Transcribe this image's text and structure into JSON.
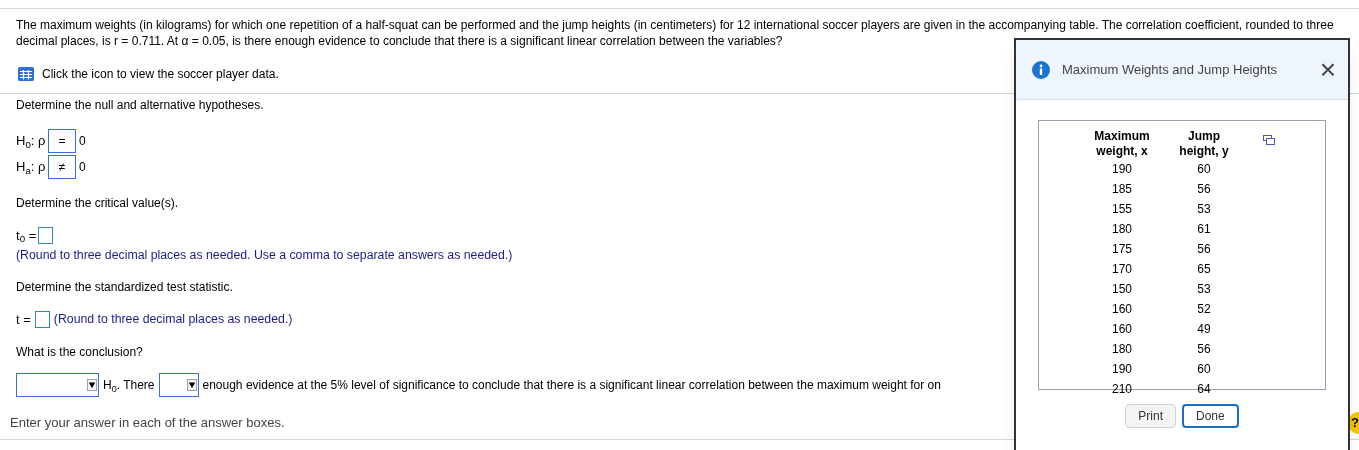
{
  "question": "The maximum weights (in kilograms) for which one repetition of a half-squat can be performed and the jump heights (in centimeters) for 12 international soccer players are given in the accompanying table. The correlation coefficient, rounded to three decimal places, is r = 0.711. At α = 0.05, is there enough evidence to conclude that there is a significant linear correlation between the variables?",
  "data_link": "Click the icon to view the soccer player data.",
  "hypotheses": {
    "prompt": "Determine the null and alternative hypotheses.",
    "rows": [
      {
        "label": "H$_{0}$: ρ",
        "value": "=",
        "rhs": "0"
      },
      {
        "label": "H$_{a}$: ρ",
        "value": "≠",
        "rhs": "0"
      }
    ]
  },
  "critical": {
    "prompt": "Determine the critical value(s).",
    "label": "t$_{0}$ =",
    "hint": "(Round to three decimal places as needed. Use a comma to separate answers as needed.)"
  },
  "statistic": {
    "prompt": "Determine the standardized test statistic.",
    "label": "t =",
    "hint": "(Round to three decimal places as needed.)"
  },
  "conclusion": {
    "prompt": "What is the conclusion?",
    "middle": "H$_{0}$. There",
    "rest": "enough evidence at the 5% level of significance to conclude that there is a significant linear correlation between the maximum weight for on"
  },
  "footer": "Enter your answer in each of the answer boxes.",
  "help": "?",
  "dialog": {
    "title": "Maximum Weights and Jump Heights",
    "close": "×",
    "columns": [
      "Maximum weight, x",
      "Jump height, y"
    ],
    "rows": [
      [
        "190",
        "60"
      ],
      [
        "185",
        "56"
      ],
      [
        "155",
        "53"
      ],
      [
        "180",
        "61"
      ],
      [
        "175",
        "56"
      ],
      [
        "170",
        "65"
      ],
      [
        "150",
        "53"
      ],
      [
        "160",
        "52"
      ],
      [
        "160",
        "49"
      ],
      [
        "180",
        "56"
      ],
      [
        "190",
        "60"
      ],
      [
        "210",
        "64"
      ]
    ],
    "buttons": [
      {
        "label": "Print",
        "selected": false
      },
      {
        "label": "Done",
        "selected": true
      }
    ]
  }
}
